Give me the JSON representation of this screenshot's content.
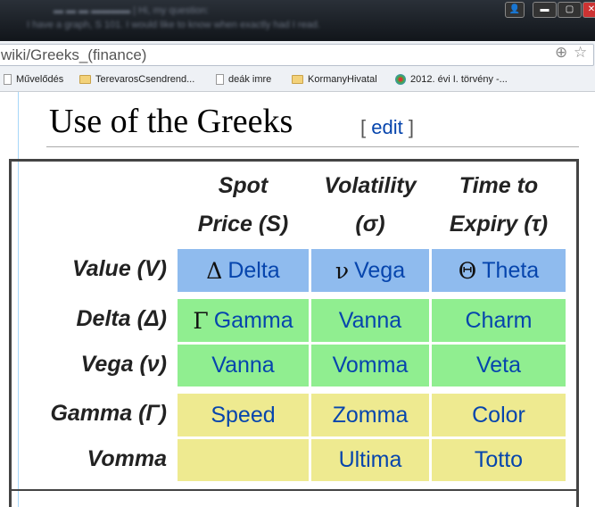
{
  "browser": {
    "blurred_text": [
      "I have a graph, S 101. I would like to know when exactly had I read."
    ],
    "address": "wiki/Greeks_(finance)",
    "bookmarks": [
      {
        "label": "Művelődés",
        "icon": "page-icon"
      },
      {
        "label": "TerevarosCsendrend...",
        "icon": "folder-icon"
      },
      {
        "label": "deák imre",
        "icon": "page-icon"
      },
      {
        "label": "KormanyHivatal",
        "icon": "folder-icon"
      },
      {
        "label": "2012. évi I. törvény -...",
        "icon": "globe-icon"
      }
    ]
  },
  "article": {
    "heading": "Use of the Greeks",
    "edit_open": "[",
    "edit": "edit",
    "edit_close": "]"
  },
  "table": {
    "col_headers": [
      {
        "line1": "Spot",
        "line2": "Price (S)"
      },
      {
        "line1": "Volatility",
        "line2": "(σ)"
      },
      {
        "line1": "Time to",
        "line2": "Expiry (τ)"
      }
    ],
    "rows": [
      {
        "label": "Value (V)",
        "color": "#8fbbee",
        "cells": [
          {
            "sym": "Δ",
            "text": "Delta"
          },
          {
            "sym": "ν",
            "text": "Vega"
          },
          {
            "sym": "Θ",
            "text": "Theta"
          }
        ]
      },
      {
        "label": "Delta (Δ)",
        "color": "#90ee90",
        "cells": [
          {
            "sym": "Γ",
            "text": "Gamma"
          },
          {
            "text": "Vanna"
          },
          {
            "text": "Charm"
          }
        ]
      },
      {
        "label": "Vega (ν)",
        "color": "#90ee90",
        "cells": [
          {
            "text": "Vanna"
          },
          {
            "text": "Vomma"
          },
          {
            "text": "Veta"
          }
        ]
      },
      {
        "label": "Gamma (Γ)",
        "color": "#eeea90",
        "cells": [
          {
            "text": "Speed"
          },
          {
            "text": "Zomma"
          },
          {
            "text": "Color"
          }
        ]
      },
      {
        "label": "Vomma",
        "color": "#eeea90",
        "cells": [
          {
            "text": ""
          },
          {
            "text": "Ultima"
          },
          {
            "text": "Totto"
          }
        ]
      }
    ]
  }
}
